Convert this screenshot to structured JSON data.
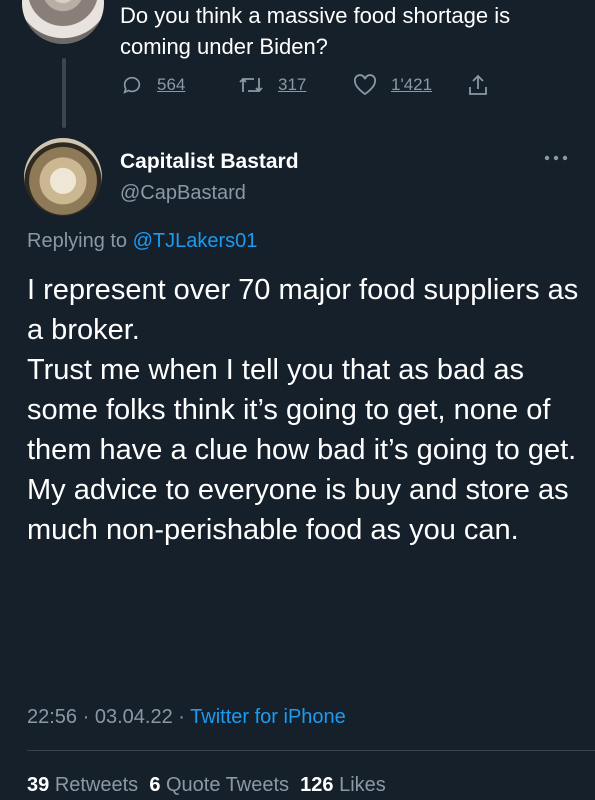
{
  "previous_tweet": {
    "text": "Do you think a massive food shortage is coming under Biden?",
    "replies": "564",
    "retweets": "317",
    "likes": "1'421",
    "icons": [
      "reply-icon",
      "retweet-icon",
      "like-icon",
      "share-icon"
    ]
  },
  "tweet": {
    "display_name": "Capitalist Bastard",
    "handle": "@CapBastard",
    "more_icon": "…",
    "replying_prefix": "Replying to",
    "replying_to": "@TJLakers01",
    "body": "I represent over 70 major food suppliers as a broker.\nTrust me when I tell you that as bad as some folks think it’s going to get, none of them have a clue how bad it’s going to get.\nMy advice to everyone is buy and store as much non-perishable food as you can.",
    "time": "22:56",
    "date": "03.04.22",
    "source": "Twitter for iPhone",
    "separator": "·"
  },
  "stats": {
    "retweets_count": "39",
    "retweets_label": "Retweets",
    "quotes_count": "6",
    "quotes_label": "Quote Tweets",
    "likes_count": "126",
    "likes_label": "Likes"
  },
  "colors": {
    "background": "#15202b",
    "muted": "#8b98a5",
    "accent": "#1d9bf0"
  }
}
